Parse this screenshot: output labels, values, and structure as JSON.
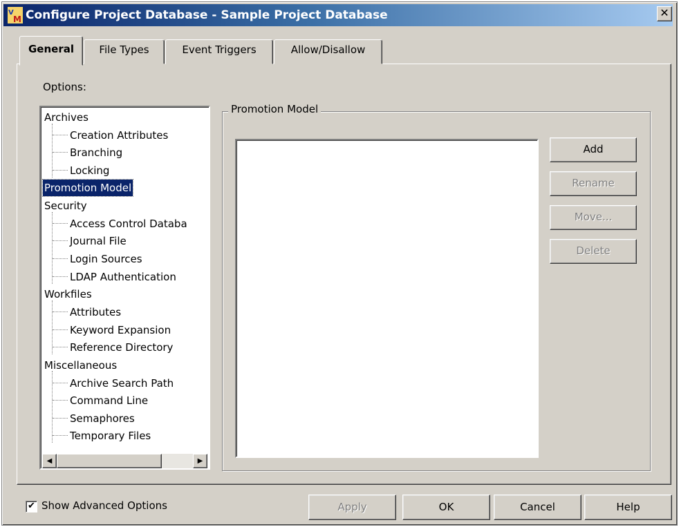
{
  "window": {
    "title": "Configure Project Database - Sample Project Database",
    "app_icon": "vm-app-icon",
    "close_label": "✕"
  },
  "tabs": [
    {
      "label": "General",
      "active": true
    },
    {
      "label": "File Types",
      "active": false
    },
    {
      "label": "Event Triggers",
      "active": false
    },
    {
      "label": "Allow/Disallow",
      "active": false
    }
  ],
  "options": {
    "label": "Options:",
    "tree": [
      {
        "label": "Archives",
        "level": 0
      },
      {
        "label": "Creation Attributes",
        "level": 1
      },
      {
        "label": "Branching",
        "level": 1
      },
      {
        "label": "Locking",
        "level": 1
      },
      {
        "label": "Promotion Model",
        "level": 0,
        "selected": true
      },
      {
        "label": "Security",
        "level": 0
      },
      {
        "label": "Access Control Databa",
        "level": 1
      },
      {
        "label": "Journal File",
        "level": 1
      },
      {
        "label": "Login Sources",
        "level": 1
      },
      {
        "label": "LDAP Authentication",
        "level": 1
      },
      {
        "label": "Workfiles",
        "level": 0
      },
      {
        "label": "Attributes",
        "level": 1
      },
      {
        "label": "Keyword Expansion",
        "level": 1
      },
      {
        "label": "Reference Directory",
        "level": 1
      },
      {
        "label": "Miscellaneous",
        "level": 0
      },
      {
        "label": "Archive Search Path",
        "level": 1
      },
      {
        "label": "Command Line",
        "level": 1
      },
      {
        "label": "Semaphores",
        "level": 1
      },
      {
        "label": "Temporary Files",
        "level": 1
      }
    ],
    "scroll_left_icon": "◀",
    "scroll_right_icon": "▶"
  },
  "promotion_model": {
    "group_label": "Promotion Model",
    "buttons": {
      "add": "Add",
      "rename": "Rename",
      "move": "Move...",
      "delete": "Delete"
    }
  },
  "footer": {
    "show_advanced_label": "Show Advanced Options",
    "show_advanced_checked": true,
    "checkmark": "✔",
    "apply": "Apply",
    "ok": "OK",
    "cancel": "Cancel",
    "help": "Help"
  },
  "colors": {
    "dialog_face": "#d4d0c8",
    "title_gradient_start": "#0a246a",
    "title_gradient_end": "#a6caf0",
    "selection": "#0a246a",
    "disabled_text": "#808080"
  }
}
